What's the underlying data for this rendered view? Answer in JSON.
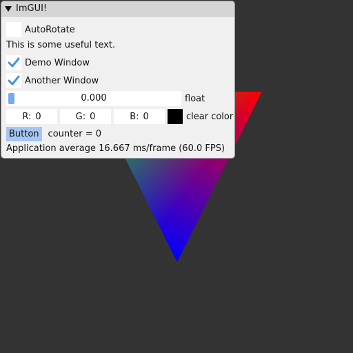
{
  "window": {
    "title": "ImGUI!"
  },
  "autorotate": {
    "label": "AutoRotate"
  },
  "useful_text": "This is some useful text.",
  "demo_window": {
    "label": "Demo Window",
    "checked": true
  },
  "another_window": {
    "label": "Another Window",
    "checked": true
  },
  "float_slider": {
    "value": "0.000",
    "label": "float"
  },
  "clear_color": {
    "r_label": "R:",
    "r_value": "0",
    "g_label": "G:",
    "g_value": "0",
    "b_label": "B:",
    "b_value": "0",
    "label": "clear color",
    "swatch": "#000000"
  },
  "button": {
    "label": "Button"
  },
  "counter_text": "counter = 0",
  "stats_text": "Application average 16.667 ms/frame (60.0 FPS)",
  "colors": {
    "background": "#333333",
    "accent": "#4a90e2",
    "triangle_red": "#ff0000",
    "triangle_green": "#00b060",
    "triangle_blue": "#0000ff"
  }
}
